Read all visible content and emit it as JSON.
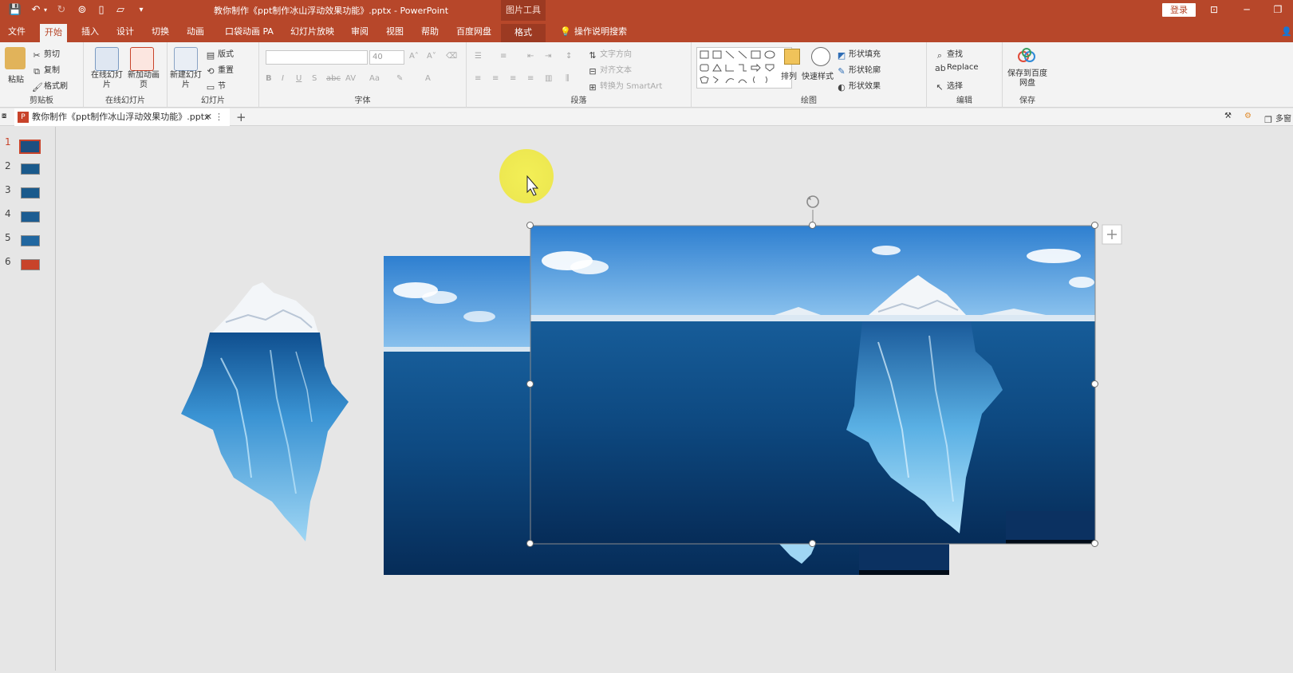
{
  "window": {
    "title": "教你制作《ppt制作冰山浮动效果功能》.pptx  -  PowerPoint",
    "picture_tools": "图片工具",
    "login": "登录"
  },
  "menu_tabs": [
    "文件",
    "开始",
    "插入",
    "设计",
    "切换",
    "动画",
    "口袋动画 PA",
    "幻灯片放映",
    "审阅",
    "视图",
    "帮助",
    "百度网盘",
    "格式"
  ],
  "search_label": "操作说明搜索",
  "ribbon": {
    "clipboard": {
      "paste": "粘贴",
      "cut": "剪切",
      "copy": "复制",
      "format_painter": "格式刷",
      "label": "剪贴板"
    },
    "online_slides": {
      "online": "在线幻灯片",
      "new_anim": "新加动画页",
      "label": "在线幻灯片"
    },
    "slides": {
      "new_slide": "新建幻灯片",
      "layout": "版式",
      "reset": "重置",
      "section": "节",
      "label": "幻灯片"
    },
    "font": {
      "size": "40",
      "label": "字体"
    },
    "paragraph": {
      "text_direction": "文字方向",
      "align_text": "对齐文本",
      "smartart": "转换为 SmartArt",
      "label": "段落"
    },
    "drawing": {
      "arrange": "排列",
      "quick_styles": "快速样式",
      "shape_fill": "形状填充",
      "shape_outline": "形状轮廓",
      "shape_effects": "形状效果",
      "label": "绘图"
    },
    "editing": {
      "find": "查找",
      "replace": "Replace",
      "select": "选择",
      "label": "编辑"
    },
    "save": {
      "save_to": "保存到百度网盘",
      "label": "保存"
    }
  },
  "doc_tab": {
    "name": "教你制作《ppt制作冰山浮动效果功能》.pptx"
  },
  "doc_tab_right": "多窗",
  "slides": [
    {
      "num": "1",
      "color": "#1d4f80"
    },
    {
      "num": "2",
      "color": "#1a5a8c"
    },
    {
      "num": "3",
      "color": "#1a5a8c"
    },
    {
      "num": "4",
      "color": "#1d5d92"
    },
    {
      "num": "5",
      "color": "#2167a0"
    },
    {
      "num": "6",
      "color": "#c8432a"
    }
  ],
  "colors": {
    "accent": "#b7472a",
    "sky": "#5aa5e0",
    "sea_top": "#1f6fb0",
    "sea_bottom": "#062c58"
  }
}
